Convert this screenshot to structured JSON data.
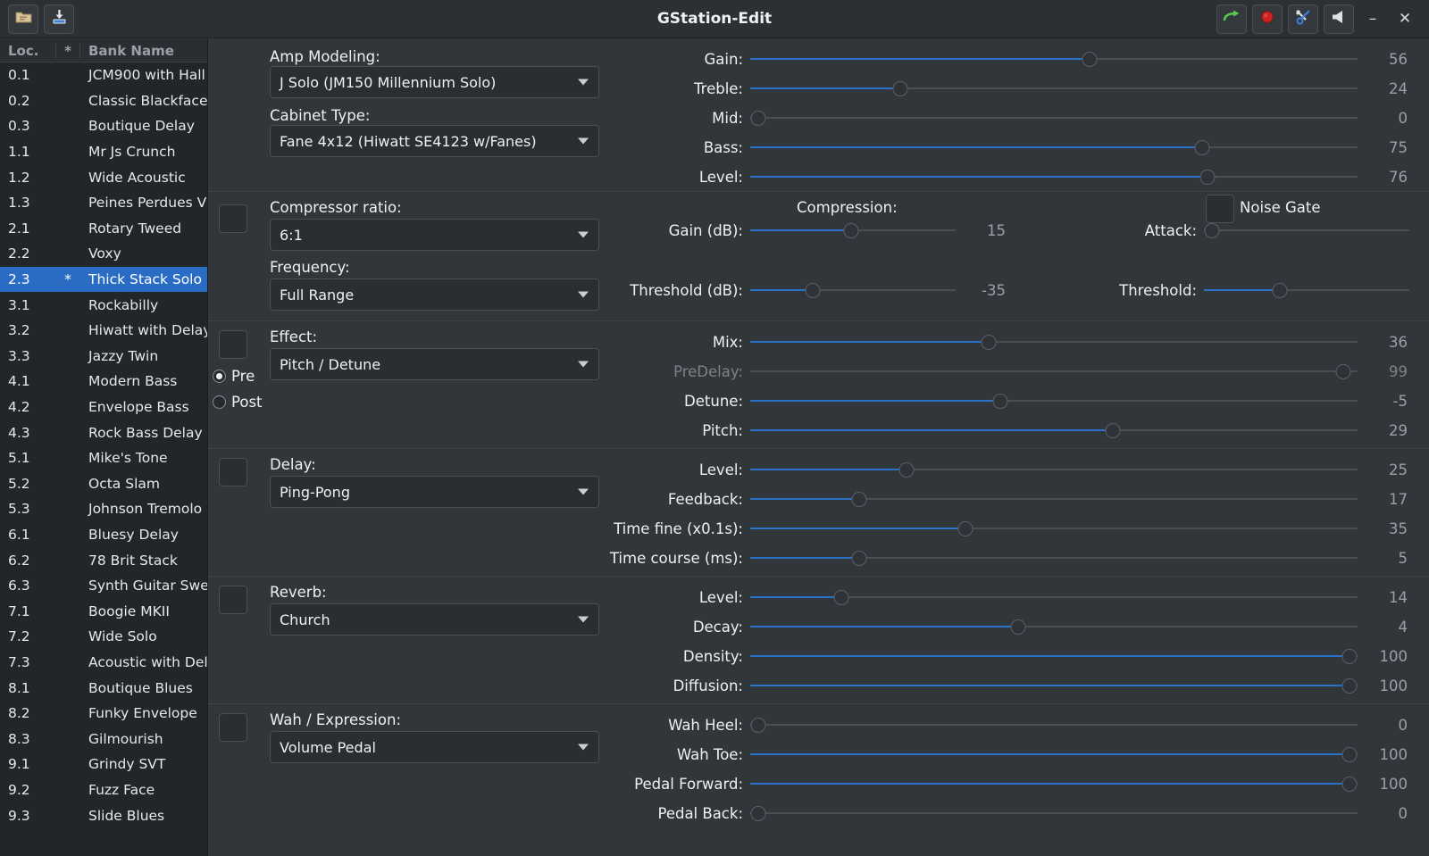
{
  "window": {
    "title": "GStation-Edit",
    "toolbar": [
      {
        "name": "open-icon",
        "glyph": "folder"
      },
      {
        "name": "save-icon",
        "glyph": "download"
      }
    ],
    "right_tools": [
      {
        "name": "sync-icon",
        "glyph": "arrow"
      },
      {
        "name": "record-icon",
        "glyph": "dot"
      },
      {
        "name": "settings-icon",
        "glyph": "tools"
      },
      {
        "name": "audio-icon",
        "glyph": "speaker"
      }
    ],
    "minimize_label": "–",
    "close_label": "✕"
  },
  "bank_list": {
    "headers": {
      "loc": "Loc.",
      "mark": "*",
      "name": "Bank Name"
    },
    "rows": [
      {
        "loc": "0.1",
        "mark": "",
        "name": "JCM900 with Hall",
        "selected": false
      },
      {
        "loc": "0.2",
        "mark": "",
        "name": "Classic Blackface",
        "selected": false
      },
      {
        "loc": "0.3",
        "mark": "",
        "name": "Boutique Delay",
        "selected": false
      },
      {
        "loc": "1.1",
        "mark": "",
        "name": "Mr Js Crunch",
        "selected": false
      },
      {
        "loc": "1.2",
        "mark": "",
        "name": "Wide Acoustic",
        "selected": false
      },
      {
        "loc": "1.3",
        "mark": "",
        "name": "Peines Perdues V",
        "selected": false
      },
      {
        "loc": "2.1",
        "mark": "",
        "name": "Rotary Tweed",
        "selected": false
      },
      {
        "loc": "2.2",
        "mark": "",
        "name": "Voxy",
        "selected": false
      },
      {
        "loc": "2.3",
        "mark": "*",
        "name": "Thick Stack Solo",
        "selected": true
      },
      {
        "loc": "3.1",
        "mark": "",
        "name": "Rockabilly",
        "selected": false
      },
      {
        "loc": "3.2",
        "mark": "",
        "name": "Hiwatt with Delay",
        "selected": false
      },
      {
        "loc": "3.3",
        "mark": "",
        "name": "Jazzy Twin",
        "selected": false
      },
      {
        "loc": "4.1",
        "mark": "",
        "name": "Modern Bass",
        "selected": false
      },
      {
        "loc": "4.2",
        "mark": "",
        "name": "Envelope Bass",
        "selected": false
      },
      {
        "loc": "4.3",
        "mark": "",
        "name": "Rock Bass Delay",
        "selected": false
      },
      {
        "loc": "5.1",
        "mark": "",
        "name": "Mike's Tone",
        "selected": false
      },
      {
        "loc": "5.2",
        "mark": "",
        "name": "Octa Slam",
        "selected": false
      },
      {
        "loc": "5.3",
        "mark": "",
        "name": "Johnson Tremolo",
        "selected": false
      },
      {
        "loc": "6.1",
        "mark": "",
        "name": "Bluesy Delay",
        "selected": false
      },
      {
        "loc": "6.2",
        "mark": "",
        "name": "78 Brit Stack",
        "selected": false
      },
      {
        "loc": "6.3",
        "mark": "",
        "name": "Synth Guitar Swell",
        "selected": false
      },
      {
        "loc": "7.1",
        "mark": "",
        "name": "Boogie MKII",
        "selected": false
      },
      {
        "loc": "7.2",
        "mark": "",
        "name": "Wide Solo",
        "selected": false
      },
      {
        "loc": "7.3",
        "mark": "",
        "name": "Acoustic with Delay",
        "selected": false
      },
      {
        "loc": "8.1",
        "mark": "",
        "name": "Boutique Blues",
        "selected": false
      },
      {
        "loc": "8.2",
        "mark": "",
        "name": "Funky Envelope",
        "selected": false
      },
      {
        "loc": "8.3",
        "mark": "",
        "name": "Gilmourish",
        "selected": false
      },
      {
        "loc": "9.1",
        "mark": "",
        "name": "Grindy SVT",
        "selected": false
      },
      {
        "loc": "9.2",
        "mark": "",
        "name": "Fuzz Face",
        "selected": false
      },
      {
        "loc": "9.3",
        "mark": "",
        "name": "Slide Blues",
        "selected": false
      }
    ]
  },
  "amp": {
    "amp_modeling_label": "Amp Modeling:",
    "amp_modeling_value": "J Solo (JM150 Millennium Solo)",
    "cabinet_label": "Cabinet Type:",
    "cabinet_value": "Fane 4x12 (Hiwatt SE4123 w/Fanes)",
    "sliders": [
      {
        "label": "Gain:",
        "value": 56,
        "pct": 56
      },
      {
        "label": "Treble:",
        "value": 24,
        "pct": 24
      },
      {
        "label": "Mid:",
        "value": 0,
        "pct": 0
      },
      {
        "label": "Bass:",
        "value": 75,
        "pct": 75
      },
      {
        "label": "Level:",
        "value": 76,
        "pct": 76
      }
    ]
  },
  "compressor": {
    "ratio_label": "Compressor ratio:",
    "ratio_value": "6:1",
    "frequency_label": "Frequency:",
    "frequency_value": "Full Range",
    "compression_label": "Compression:",
    "noise_gate_label": "Noise Gate",
    "comp_sliders": [
      {
        "label": "Gain (dB):",
        "value": 15,
        "pct": 49
      },
      {
        "label": "Threshold (dB):",
        "value": -35,
        "pct": 29
      }
    ],
    "gate_sliders": [
      {
        "label": "Attack:",
        "value": 0,
        "pct": 0
      },
      {
        "label": "Threshold:",
        "value": 36,
        "pct": 36
      }
    ]
  },
  "effect": {
    "label": "Effect:",
    "value": "Pitch / Detune",
    "pre_label": "Pre",
    "post_label": "Post",
    "pre_selected": true,
    "sliders": [
      {
        "label": "Mix:",
        "value": 36,
        "pct": 39,
        "disabled": false
      },
      {
        "label": "PreDelay:",
        "value": 99,
        "pct": 99,
        "disabled": true
      },
      {
        "label": "Detune:",
        "value": -5,
        "pct": 41,
        "disabled": false
      },
      {
        "label": "Pitch:",
        "value": 29,
        "pct": 60,
        "disabled": false
      }
    ]
  },
  "delay": {
    "label": "Delay:",
    "value": "Ping-Pong",
    "sliders": [
      {
        "label": "Level:",
        "value": 25,
        "pct": 25
      },
      {
        "label": "Feedback:",
        "value": 17,
        "pct": 17
      },
      {
        "label": "Time fine (x0.1s):",
        "value": 35,
        "pct": 35
      },
      {
        "label": "Time course (ms):",
        "value": 5,
        "pct": 17
      }
    ]
  },
  "reverb": {
    "label": "Reverb:",
    "value": "Church",
    "sliders": [
      {
        "label": "Level:",
        "value": 14,
        "pct": 14
      },
      {
        "label": "Decay:",
        "value": 4,
        "pct": 44
      },
      {
        "label": "Density:",
        "value": 100,
        "pct": 100
      },
      {
        "label": "Diffusion:",
        "value": 100,
        "pct": 100
      }
    ]
  },
  "wah": {
    "label": "Wah / Expression:",
    "value": "Volume Pedal",
    "sliders": [
      {
        "label": "Wah Heel:",
        "value": 0,
        "pct": 0
      },
      {
        "label": "Wah Toe:",
        "value": 100,
        "pct": 100
      },
      {
        "label": "Pedal Forward:",
        "value": 100,
        "pct": 100
      },
      {
        "label": "Pedal Back:",
        "value": 0,
        "pct": 0
      }
    ]
  },
  "colors": {
    "accent": "#2a72c8",
    "selection": "#2a6cc4",
    "background": "#31363b",
    "panel": "#232629"
  }
}
